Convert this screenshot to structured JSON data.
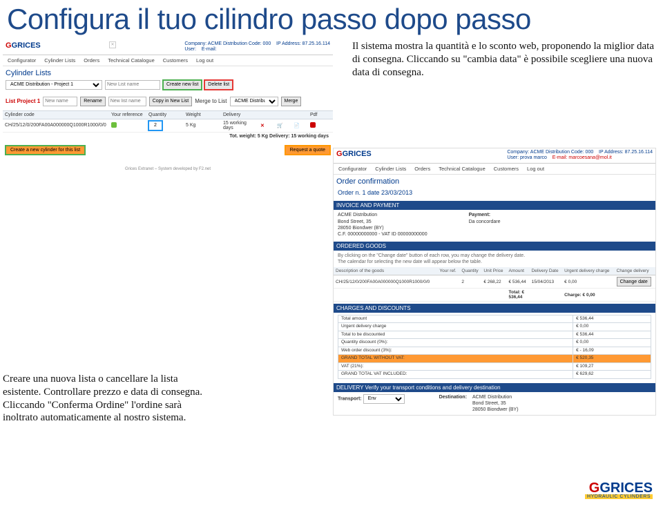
{
  "page_title": "Configura il tuo cilindro passo dopo passo",
  "side1": "Il sistema mostra la quantità e lo sconto web, proponendo la miglior data di consegna. Cliccando su \"cambia data\" è possibile scegliere una nuova data di consegna.",
  "side2": "Creare una nuova lista o cancellare la lista esistente. Controllare prezzo e data di consegna. Cliccando \"Conferma Ordine\" l'ordine sarà inoltrato automaticamente al nostro sistema.",
  "logo_name": "GRICES",
  "logo_sub": "HYDRAULIC CYLINDERS",
  "app1": {
    "header": {
      "company": "Company: ACME Distribution  Code: 000",
      "user": "User:",
      "ip": "IP Address: 87.25.16.114",
      "email": "E-mail:"
    },
    "nav": [
      "Configurator",
      "Cylinder Lists",
      "Orders",
      "Technical Catalogue",
      "Customers",
      "Log out"
    ],
    "title": "Cylinder Lists",
    "proj_select": "ACME Distribution - Project 1",
    "new_list_ph": "New List name",
    "btn_create": "Create new list",
    "btn_delete": "Delete list",
    "listrow": {
      "name": "List Project 1",
      "newname_ph": "New name",
      "rename": "Rename",
      "newlistname_ph": "New list name",
      "copy": "Copy in New List",
      "merge_label": "Merge to List",
      "merge_sel": "ACME Distributi",
      "merge_btn": "Merge"
    },
    "cols": [
      "Cylinder code",
      "Your reference",
      "Quantity",
      "Weight",
      "Delivery",
      "",
      "",
      "",
      "Pdf"
    ],
    "row": {
      "code": "CH/25/12/0/200FA00A000000Q1000R1000/0/0",
      "qty": "2",
      "wt": "5 Kg",
      "deliv": "15 working days"
    },
    "totals": "Tot. weight: 5 Kg      Delivery: 15 working days",
    "btn_newcyl": "Create a new cylinder for this list",
    "btn_quote": "Request a quote",
    "foot": "Grices Extranet – System developed by F2.net"
  },
  "app2": {
    "header": {
      "company": "Company: ACME Distribution  Code: 000",
      "user": "User: prova marco",
      "ip": "IP Address: 87.25.16.114",
      "email": "E-mail: marcoesana@mol.it"
    },
    "nav": [
      "Configurator",
      "Cylinder Lists",
      "Orders",
      "Technical Catalogue",
      "Customers",
      "Log out"
    ],
    "title": "Order confirmation",
    "order_no": "Order n. 1 date 23/03/2013",
    "band1": "INVOICE AND PAYMENT",
    "inv": {
      "l1": "ACME Distribution",
      "l2": "Bond Street, 35",
      "l3": "28050 Biondwer (BY)",
      "l4": "C.F. 00000000000 - VAT ID 00000000000",
      "pay_lbl": "Payment:",
      "pay_val": "Da concordare"
    },
    "band2": "ORDERED GOODS",
    "hint1": "By clicking on the \"Change date\" button of each row, you may change the delivery date.",
    "hint2": "The calendar for selecting the new date will appear below the table.",
    "cols": [
      "Description of the goods",
      "Your ref.",
      "Quantity",
      "Unit Price",
      "Amount",
      "Delivery Date",
      "Urgent delivery charge",
      "Change delivery"
    ],
    "row": {
      "desc": "CH/25/12/0/200FA00A000000Q1000R1000/0/0",
      "qty": "2",
      "uprice": "€ 268,22",
      "amount": "€ 536,44",
      "ddate": "15/04/2013",
      "urg": "€ 0,00",
      "chg": "Change date"
    },
    "totals": {
      "tlabel": "Total: €",
      "tval": "536,44",
      "clabel": "Charge: € 0,00"
    },
    "band3": "CHARGES AND DISCOUNTS",
    "charges": [
      [
        "Total amount",
        "€ 536,44"
      ],
      [
        "Urgent delivery charge",
        "€ 0,00"
      ],
      [
        "Total to be discounted",
        "€ 536,44"
      ],
      [
        "Quantity discount (0%):",
        "€ 0,00"
      ],
      [
        "Web order discount (3%):",
        "€ - 16,09"
      ]
    ],
    "gtot": [
      [
        "GRAND TOTAL WITHOUT VAT:",
        "€ 520,35"
      ],
      [
        "VAT (21%):",
        "€ 109,27"
      ],
      [
        "GRAND TOTAL VAT INCLUDED:",
        "€ 629,62"
      ]
    ],
    "band4": "DELIVERY  Verify your transport conditions and delivery destination",
    "transport_lbl": "Transport:",
    "transport_val": "Env",
    "dest_lbl": "Destination:",
    "dest": [
      "ACME Distribution",
      "Bond Street, 35",
      "28050 Biondwer (BY)"
    ]
  }
}
